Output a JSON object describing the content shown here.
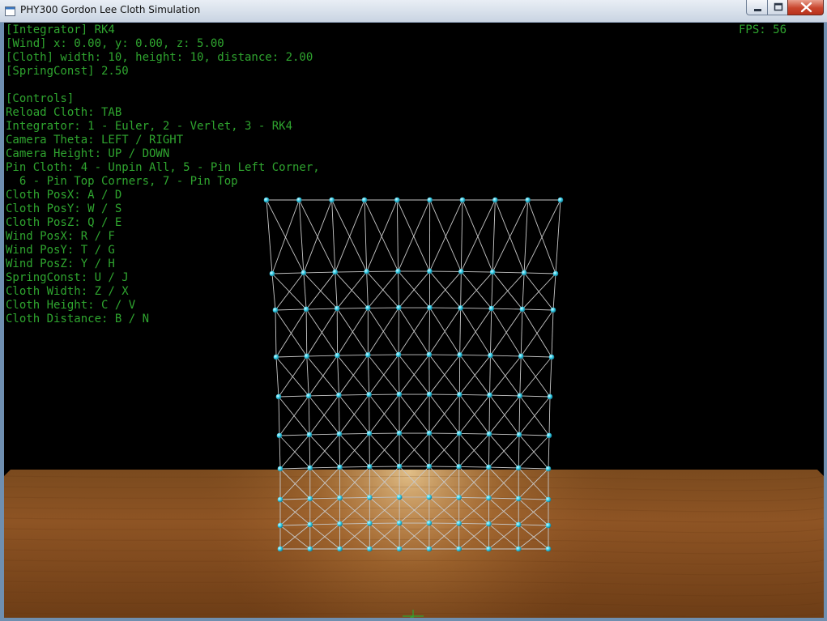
{
  "window": {
    "title": "PHY300 Gordon Lee Cloth Simulation",
    "icon": "app-window-icon",
    "controls": [
      "minimize-icon",
      "maximize-icon",
      "close-icon"
    ]
  },
  "hud": {
    "lines": [
      "[Integrator] RK4",
      "[Wind] x: 0.00, y: 0.00, z: 5.00",
      "[Cloth] width: 10, height: 10, distance: 2.00",
      "[SpringConst] 2.50",
      "",
      "[Controls]",
      "Reload Cloth: TAB",
      "Integrator: 1 - Euler, 2 - Verlet, 3 - RK4",
      "Camera Theta: LEFT / RIGHT",
      "Camera Height: UP / DOWN",
      "Pin Cloth: 4 - Unpin All, 5 - Pin Left Corner,",
      "  6 - Pin Top Corners, 7 - Pin Top",
      "Cloth PosX: A / D",
      "Cloth PosY: W / S",
      "Cloth PosZ: Q / E",
      "Wind PosX: R / F",
      "Wind PosY: T / G",
      "Wind PosZ: Y / H",
      "SpringConst: U / J",
      "Cloth Width: Z / X",
      "Cloth Height: C / V",
      "Cloth Distance: B / N"
    ],
    "fps": "FPS: 56"
  },
  "cloth": {
    "width": 10,
    "height": 10,
    "distance": 2.0
  },
  "colors": {
    "hud_text": "#2fa52f",
    "background": "#000000",
    "node": "#37d0ea",
    "spring": "#c8c8c8",
    "floor": "#9a5a22"
  }
}
